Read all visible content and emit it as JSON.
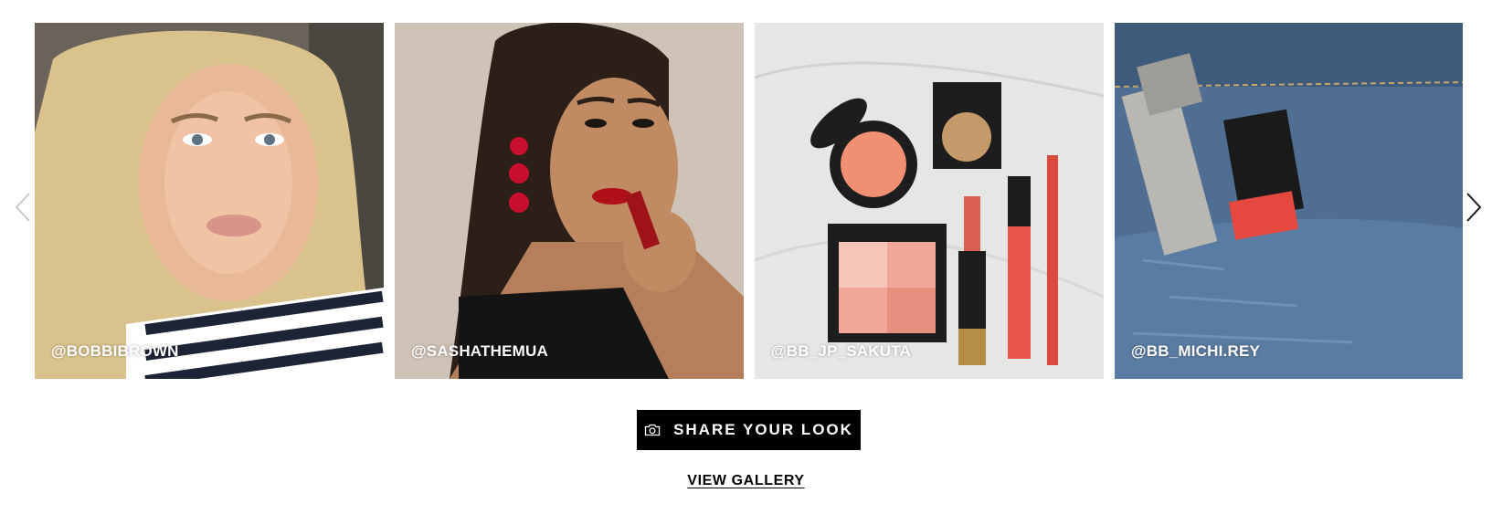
{
  "carousel": {
    "prev_icon": "chevron-left-icon",
    "next_icon": "chevron-right-icon",
    "tiles": [
      {
        "handle": "@BOBBIBROWN",
        "image": "blonde-woman-selfie-striped-shirt"
      },
      {
        "handle": "@SASHATHEMUA",
        "image": "woman-applying-red-lipstick"
      },
      {
        "handle": "@BB_JP_SAKUTA",
        "image": "makeup-products-flatlay-marble"
      },
      {
        "handle": "@BB_MICHI.REY",
        "image": "lipsticks-in-denim-pocket"
      }
    ]
  },
  "actions": {
    "share_label": "SHARE YOUR LOOK",
    "share_icon": "camera-icon",
    "gallery_label": "VIEW GALLERY"
  },
  "colors": {
    "button_bg": "#000000",
    "button_text": "#ffffff",
    "accent_red": "#c8102e"
  }
}
